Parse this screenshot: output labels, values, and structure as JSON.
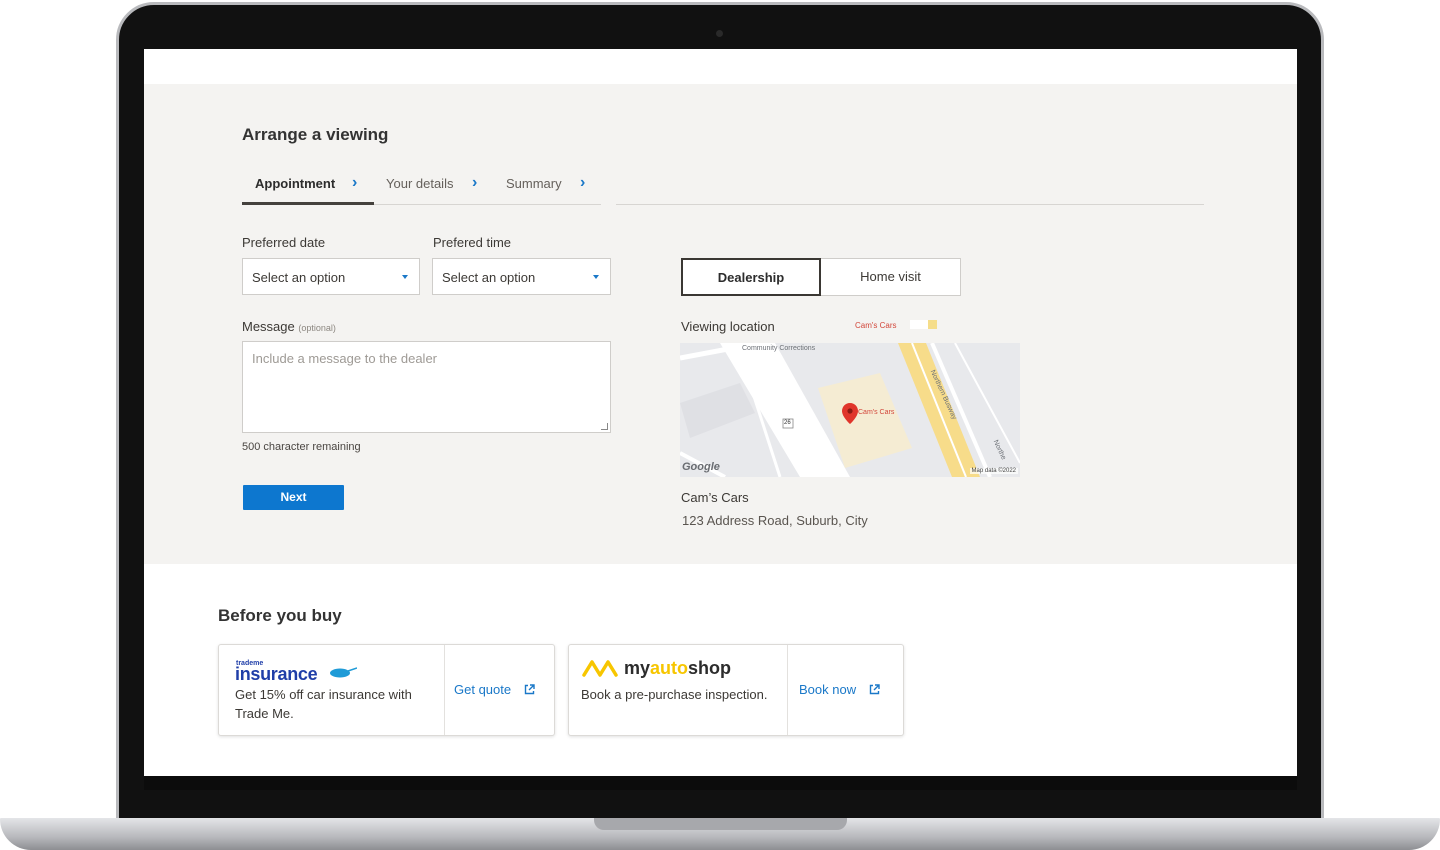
{
  "page": {
    "title": "Arrange a viewing",
    "steps": [
      {
        "label": "Appointment"
      },
      {
        "label": "Your details"
      },
      {
        "label": "Summary"
      }
    ]
  },
  "form": {
    "date_label": "Preferred date",
    "date_value": "Select an option",
    "time_label": "Prefered time",
    "time_value": "Select an option",
    "message_label": "Message",
    "message_optional": "(optional)",
    "message_placeholder": "Include a message to the dealer",
    "remaining": "500 character remaining",
    "next_label": "Next"
  },
  "location": {
    "toggle_dealership": "Dealership",
    "toggle_home": "Home visit",
    "viewing_label": "Viewing location",
    "map_pin_label": "Cam's Cars",
    "map_top_label": "Cam's Cars",
    "map_poi": "Community Corrections",
    "map_road": "Northern Busway",
    "map_road2": "Northe",
    "map_badge": "26",
    "map_google": "Google",
    "map_attribution": "Map data ©2022",
    "dealer_name": "Cam’s Cars",
    "dealer_address": "123 Address Road, Suburb, City"
  },
  "before_you_buy": {
    "title": "Before you buy",
    "cards": [
      {
        "brand_small": "trademe",
        "brand": "insurance",
        "description": "Get 15% off car insurance with Trade Me.",
        "link": "Get quote"
      },
      {
        "brand_prefix": "my",
        "brand_accent": "auto",
        "brand_suffix": "shop",
        "description": "Book a pre-purchase inspection.",
        "link": "Book now"
      }
    ]
  },
  "colors": {
    "primary": "#0d77cf",
    "link": "#1a78c8",
    "section_bg": "#f4f3f1",
    "insurance_blue": "#1f3ea8",
    "myautoshop_yellow": "#f7c600"
  }
}
